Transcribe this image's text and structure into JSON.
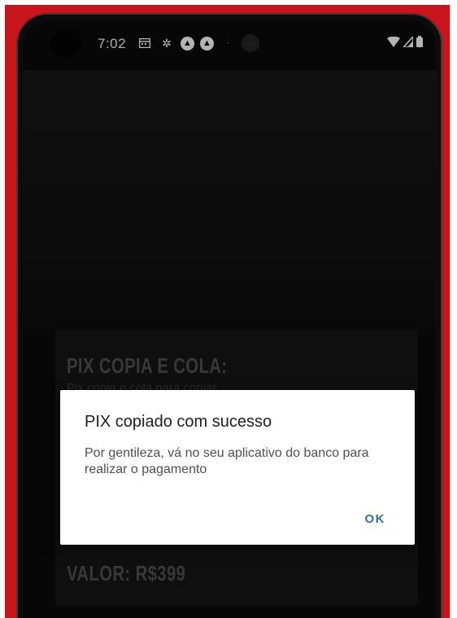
{
  "status_bar": {
    "time": "7:02",
    "left_icons": [
      "calendar-icon",
      "gear-icon",
      "app-icon",
      "app-icon",
      "notification-dot-icon"
    ],
    "right_icons": [
      "wifi-icon",
      "signal-icon",
      "battery-icon"
    ]
  },
  "background_card": {
    "title": "PIX COPIA E COLA:",
    "subtitle": "Pix copia e cola para copiar",
    "value_label": "VALOR: R$399"
  },
  "dialog": {
    "title": "PIX copiado com sucesso",
    "message": "Por gentileza, vá no seu aplicativo do banco para realizar o pagamento",
    "ok_label": "OK"
  },
  "colors": {
    "frame": "#c8151b",
    "screen": "#0a0a0a",
    "accent": "#2e6fa8"
  }
}
